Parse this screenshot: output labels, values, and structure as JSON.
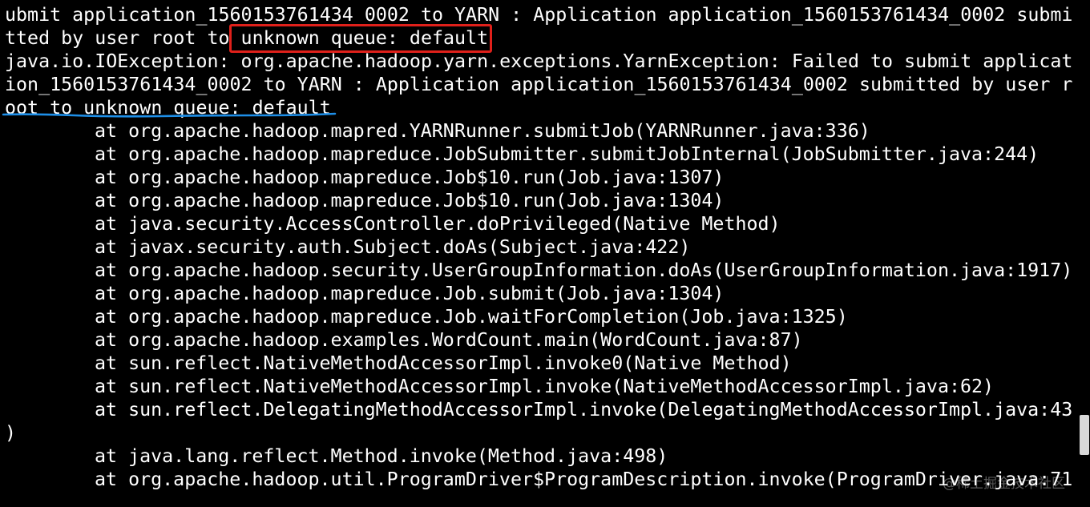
{
  "terminal": {
    "lines": [
      "ubmit application_1560153761434_0002 to YARN : Application application_1560153761434_0002 submi",
      "tted by user root to unknown queue: default",
      "java.io.IOException: org.apache.hadoop.yarn.exceptions.YarnException: Failed to submit applicat",
      "ion_1560153761434_0002 to YARN : Application application_1560153761434_0002 submitted by user r",
      "oot to unknown queue: default",
      "at org.apache.hadoop.mapred.YARNRunner.submitJob(YARNRunner.java:336)",
      "at org.apache.hadoop.mapreduce.JobSubmitter.submitJobInternal(JobSubmitter.java:244)",
      "at org.apache.hadoop.mapreduce.Job$10.run(Job.java:1307)",
      "at org.apache.hadoop.mapreduce.Job$10.run(Job.java:1304)",
      "at java.security.AccessController.doPrivileged(Native Method)",
      "at javax.security.auth.Subject.doAs(Subject.java:422)",
      "at org.apache.hadoop.security.UserGroupInformation.doAs(UserGroupInformation.java:1917)",
      "at org.apache.hadoop.mapreduce.Job.submit(Job.java:1304)",
      "at org.apache.hadoop.mapreduce.Job.waitForCompletion(Job.java:1325)",
      "at org.apache.hadoop.examples.WordCount.main(WordCount.java:87)",
      "at sun.reflect.NativeMethodAccessorImpl.invoke0(Native Method)",
      "at sun.reflect.NativeMethodAccessorImpl.invoke(NativeMethodAccessorImpl.java:62)",
      "at sun.reflect.DelegatingMethodAccessorImpl.invoke(DelegatingMethodAccessorImpl.java:43",
      ")",
      "at java.lang.reflect.Method.invoke(Method.java:498)",
      "at org.apache.hadoop.util.ProgramDriver$ProgramDescription.invoke(ProgramDriver.java:71"
    ],
    "text_color": "#ffffff",
    "background_color": "#000000"
  },
  "annotations": {
    "highlight_box_color": "#e0201a",
    "underline_color": "#1e8fe8"
  },
  "watermark": {
    "text": "@稀土掘金技术社区"
  }
}
